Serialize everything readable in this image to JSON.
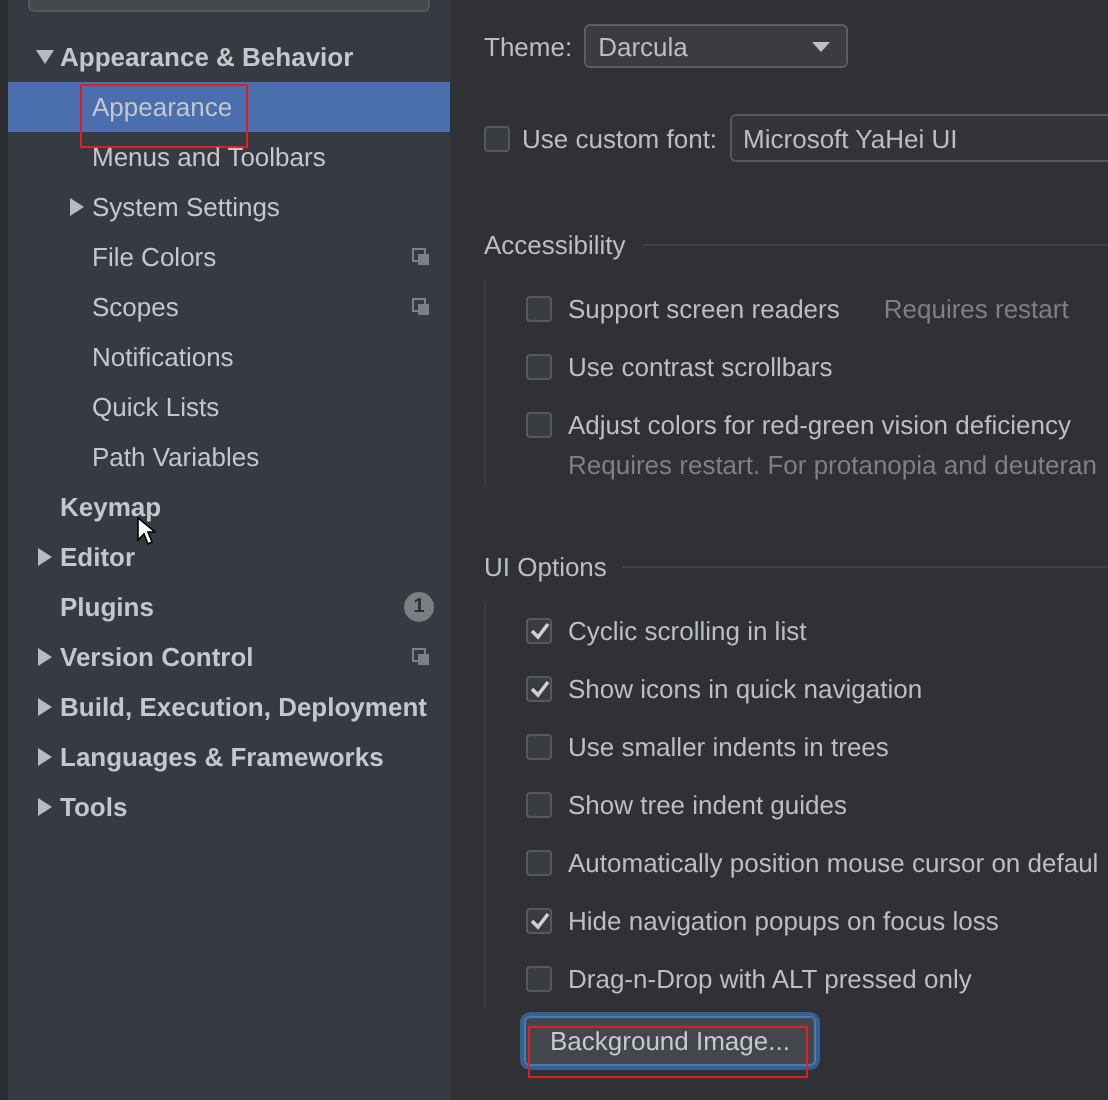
{
  "sidebar": {
    "items": [
      {
        "label": "Appearance & Behavior",
        "expanded": true,
        "selected": false,
        "children": [
          {
            "label": "Appearance",
            "selected": true,
            "highlighted": true
          },
          {
            "label": "Menus and Toolbars",
            "selected": false
          },
          {
            "label": "System Settings",
            "expanded": false,
            "selected": false
          },
          {
            "label": "File Colors",
            "selected": false,
            "project_icon": true
          },
          {
            "label": "Scopes",
            "selected": false,
            "project_icon": true
          },
          {
            "label": "Notifications",
            "selected": false
          },
          {
            "label": "Quick Lists",
            "selected": false
          },
          {
            "label": "Path Variables",
            "selected": false
          }
        ]
      },
      {
        "label": "Keymap",
        "selected": false
      },
      {
        "label": "Editor",
        "expanded": false,
        "selected": false
      },
      {
        "label": "Plugins",
        "selected": false,
        "badge": "1"
      },
      {
        "label": "Version Control",
        "expanded": false,
        "selected": false,
        "project_icon": true
      },
      {
        "label": "Build, Execution, Deployment",
        "expanded": false,
        "selected": false
      },
      {
        "label": "Languages & Frameworks",
        "expanded": false,
        "selected": false
      },
      {
        "label": "Tools",
        "expanded": false,
        "selected": false
      }
    ]
  },
  "content": {
    "theme": {
      "label": "Theme:",
      "value": "Darcula"
    },
    "custom_font": {
      "label": "Use custom font:",
      "checked": false,
      "value": "Microsoft YaHei UI"
    },
    "sections": [
      {
        "title": "Accessibility",
        "options": [
          {
            "label": "Support screen readers",
            "checked": false,
            "hint": "Requires restart"
          },
          {
            "label": "Use contrast scrollbars",
            "checked": false
          },
          {
            "label": "Adjust colors for red-green vision deficiency",
            "checked": false,
            "note": "Requires restart. For protanopia and deuteran"
          }
        ]
      },
      {
        "title": "UI Options",
        "options": [
          {
            "label": "Cyclic scrolling in list",
            "checked": true
          },
          {
            "label": "Show icons in quick navigation",
            "checked": true
          },
          {
            "label": "Use smaller indents in trees",
            "checked": false
          },
          {
            "label": "Show tree indent guides",
            "checked": false
          },
          {
            "label": "Automatically position mouse cursor on defaul",
            "checked": false
          },
          {
            "label": "Hide navigation popups on focus loss",
            "checked": true
          },
          {
            "label": "Drag-n-Drop with ALT pressed only",
            "checked": false
          }
        ]
      }
    ],
    "button": {
      "label": "Background Image...",
      "focused": true,
      "highlighted": true
    }
  }
}
